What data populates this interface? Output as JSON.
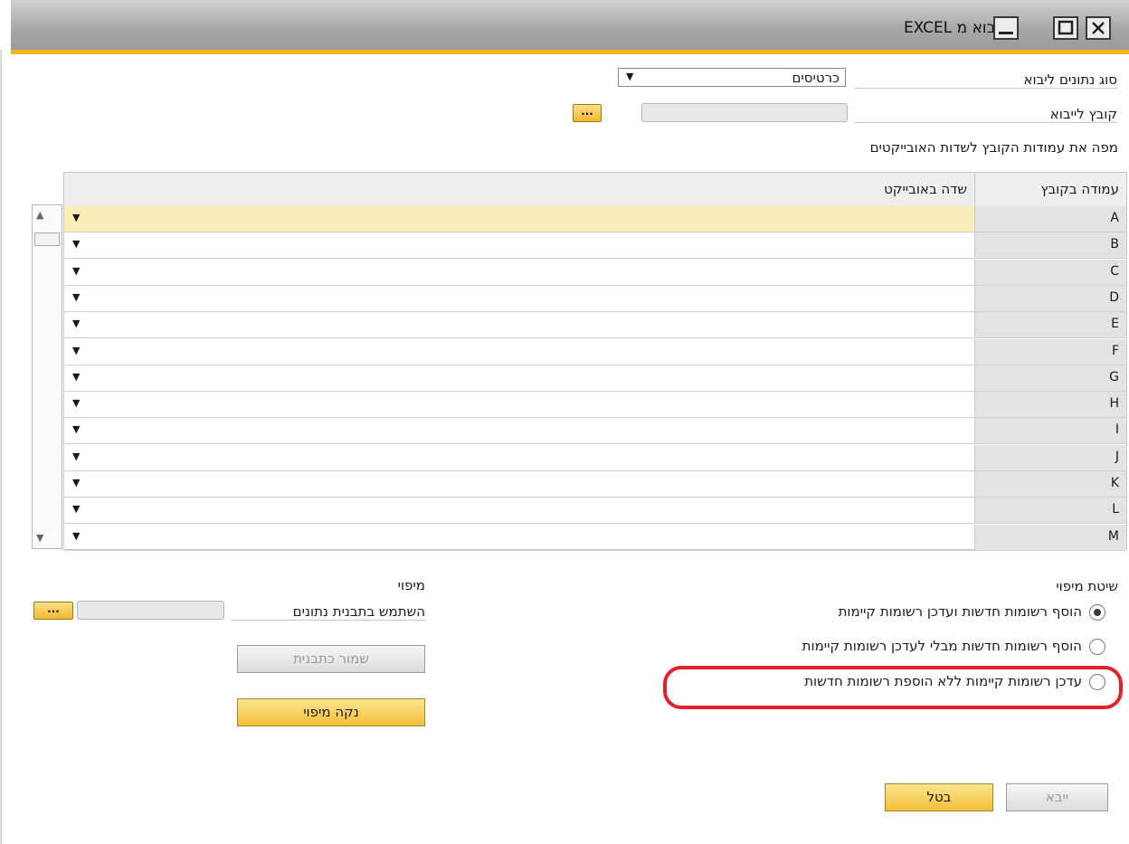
{
  "window": {
    "title": "ייבוא מ EXCEL",
    "minimize_icon": "minimize-icon",
    "maximize_icon": "maximize-icon",
    "close_icon": "close-icon"
  },
  "form": {
    "data_type_label": "סוג נתונים ליבוא",
    "data_type_value": "כרטיסים",
    "file_label": "קובץ לייבוא",
    "browse_label": "...",
    "map_heading": "מפה את עמודות הקובץ לשדות האובייקטים"
  },
  "grid": {
    "col_file": "עמודה בקובץ",
    "col_field": "שדה באובייקט",
    "rows": [
      "A",
      "B",
      "C",
      "D",
      "E",
      "F",
      "G",
      "H",
      "I",
      "J",
      "K",
      "L",
      "M"
    ]
  },
  "mapping_method": {
    "title": "שיטת מיפוי",
    "options": [
      "הוסף רשומות חדשות ועדכן רשומות קיימות",
      "הוסף רשומות חדשות מבלי לעדכן רשומות קיימות",
      "עדכן רשומות קיימות ללא הוספת רשומות חדשות"
    ],
    "selected_index": 0
  },
  "mapping": {
    "title": "מיפוי",
    "use_template_label": "השתמש בתבנית נתונים",
    "browse_label": "...",
    "save_template": "שמור כתבנית",
    "clear_mapping": "נקה מיפוי"
  },
  "footer": {
    "import": "ייבא",
    "cancel": "בטל"
  },
  "colors": {
    "accent": "#f2b51c",
    "annotation": "#e3212d"
  }
}
